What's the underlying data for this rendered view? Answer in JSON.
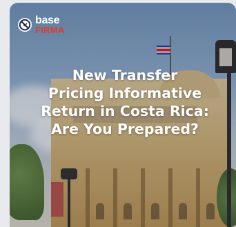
{
  "brand": {
    "name_top": "base",
    "name_bottom": "FIRMA",
    "accent_color": "#e23b2e",
    "icon": "no-entry-logo-icon"
  },
  "post": {
    "headline_lines": [
      "New Transfer",
      "Pricing Informative",
      "Return in Costa Rica:",
      "Are You Prepared?"
    ]
  }
}
